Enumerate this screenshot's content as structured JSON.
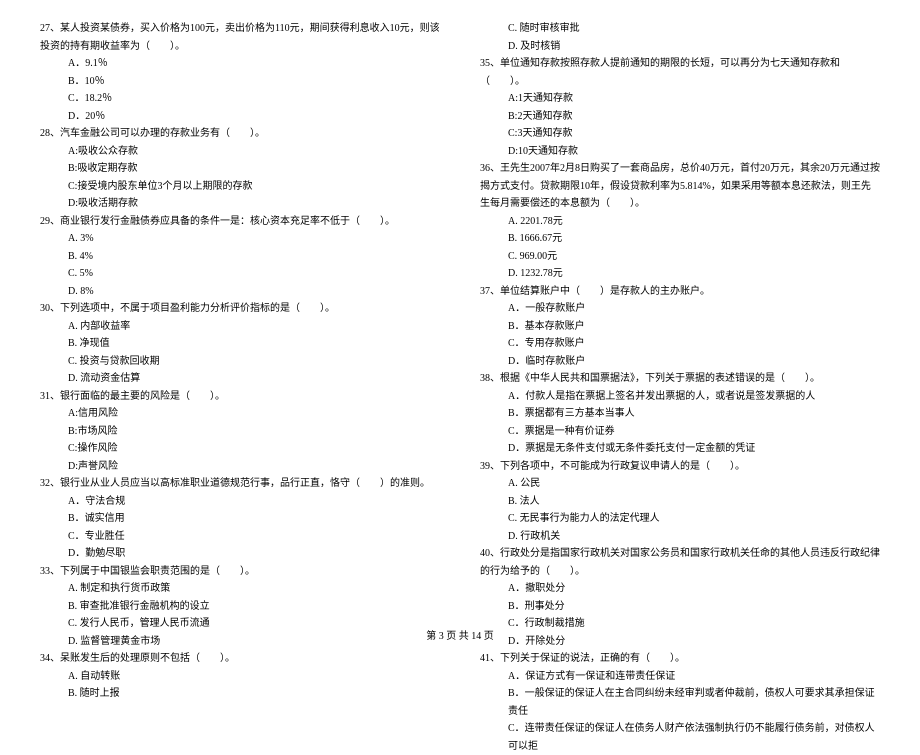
{
  "left": {
    "q27": {
      "stem": "27、某人投资某债券，买入价格为100元，卖出价格为110元，期间获得利息收入10元，则该投资的持有期收益率为（　　）。",
      "a": "A．9.1％",
      "b": "B．10％",
      "c": "C．18.2％",
      "d": "D．20％"
    },
    "q28": {
      "stem": "28、汽车金融公司可以办理的存款业务有（　　）。",
      "a": "A:吸收公众存款",
      "b": "B:吸收定期存款",
      "c": "C:接受境内股东单位3个月以上期限的存款",
      "d": "D:吸收活期存款"
    },
    "q29": {
      "stem": "29、商业银行发行金融债券应具备的条件一是：核心资本充足率不低于（　　）。",
      "a": "A. 3%",
      "b": "B. 4%",
      "c": "C. 5%",
      "d": "D. 8%"
    },
    "q30": {
      "stem": "30、下列选项中，不属于项目盈利能力分析评价指标的是（　　）。",
      "a": "A. 内部收益率",
      "b": "B. 净现值",
      "c": "C. 投资与贷款回收期",
      "d": "D. 流动资金估算"
    },
    "q31": {
      "stem": "31、银行面临的最主要的风险是（　　）。",
      "a": "A:信用风险",
      "b": "B:市场风险",
      "c": "C:操作风险",
      "d": "D:声誉风险"
    },
    "q32": {
      "stem": "32、银行业从业人员应当以高标准职业道德规范行事，品行正直，恪守（　　）的准则。",
      "a": "A．守法合规",
      "b": "B．诚实信用",
      "c": "C．专业胜任",
      "d": "D．勤勉尽职"
    },
    "q33": {
      "stem": "33、下列属于中国银监会职责范围的是（　　）。",
      "a": "A. 制定和执行货币政策",
      "b": "B. 审查批准银行金融机构的设立",
      "c": "C. 发行人民币，管理人民币流通",
      "d": "D. 监督管理黄金市场"
    },
    "q34": {
      "stem": "34、呆账发生后的处理原则不包括（　　）。",
      "a": "A. 自动转账",
      "b": "B. 随时上报"
    }
  },
  "right": {
    "q34c": "C. 随时审核审批",
    "q34d": "D. 及时核销",
    "q35": {
      "stem": "35、单位通知存款按照存款人提前通知的期限的长短，可以再分为七天通知存款和（　　）。",
      "a": "A:1天通知存款",
      "b": "B:2天通知存款",
      "c": "C:3天通知存款",
      "d": "D:10天通知存款"
    },
    "q36": {
      "stem": "36、王先生2007年2月8日购买了一套商品房，总价40万元，首付20万元，其余20万元通过按揭方式支付。贷款期限10年，假设贷款利率为5.814%，如果采用等额本息还款法，则王先生每月需要偿还的本息额为（　　）。",
      "a": "A. 2201.78元",
      "b": "B. 1666.67元",
      "c": "C. 969.00元",
      "d": "D. 1232.78元"
    },
    "q37": {
      "stem": "37、单位结算账户中（　　）是存款人的主办账户。",
      "a": "A．一般存款账户",
      "b": "B．基本存款账户",
      "c": "C．专用存款账户",
      "d": "D．临时存款账户"
    },
    "q38": {
      "stem": "38、根据《中华人民共和国票据法》，下列关于票据的表述错误的是（　　）。",
      "a": "A．付款人是指在票据上签名并发出票据的人，或者说是签发票据的人",
      "b": "B．票据都有三方基本当事人",
      "c": "C．票据是一种有价证券",
      "d": "D．票据是无条件支付或无条件委托支付一定金额的凭证"
    },
    "q39": {
      "stem": "39、下列各项中，不可能成为行政复议申请人的是（　　）。",
      "a": "A. 公民",
      "b": "B. 法人",
      "c": "C. 无民事行为能力人的法定代理人",
      "d": "D. 行政机关"
    },
    "q40": {
      "stem": "40、行政处分是指国家行政机关对国家公务员和国家行政机关任命的其他人员违反行政纪律的行为给予的（　　）。",
      "a": "A．撤职处分",
      "b": "B．刑事处分",
      "c": "C．行政制裁措施",
      "d": "D．开除处分"
    },
    "q41": {
      "stem": "41、下列关于保证的说法，正确的有（　　）。",
      "a": "A．保证方式有一保证和连带责任保证",
      "b": "B．一般保证的保证人在主合同纠纷未经审判或者仲裁前，债权人可要求其承担保证责任",
      "c": "C．连带责任保证的保证人在债务人财产依法强制执行仍不能履行债务前，对债权人可以拒"
    }
  },
  "footer": "第 3 页 共 14 页"
}
